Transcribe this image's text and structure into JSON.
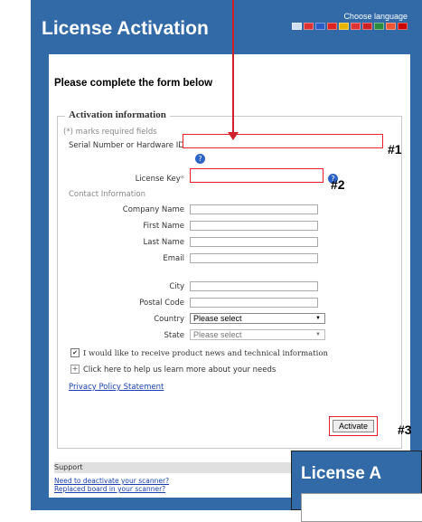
{
  "window": {
    "title": "License Activation",
    "choose_language": "Choose language",
    "flags": [
      "#cfe0f2",
      "#d33",
      "#2a5cc6",
      "#d22",
      "#e8b400",
      "#d33",
      "#c22",
      "#2c8a3c",
      "#e53",
      "#c00"
    ]
  },
  "form": {
    "heading": "Please complete the form below",
    "legend": "Activation information",
    "required_note": "(*) marks required fields",
    "serial_label": "Serial Number or Hardware ID",
    "serial_value": "",
    "license_label": "License Key",
    "license_star": "*",
    "license_value": "",
    "contact_info": "Contact Information",
    "company_label": "Company Name",
    "first_name_label": "First Name",
    "last_name_label": "Last Name",
    "email_label": "Email",
    "city_label": "City",
    "postal_label": "Postal Code",
    "country_label": "Country",
    "country_value": "Please select",
    "state_label": "State",
    "state_value": "Please select",
    "newsletter_text": "I would like to receive product news and technical information",
    "newsletter_checked": true,
    "expand_text": "Click here to help us learn more about your needs",
    "privacy_link": "Privacy Policy Statement",
    "activate_label": "Activate"
  },
  "support": {
    "title": "Support",
    "link_deactivate": "Need to deactivate your scanner?",
    "link_replaced": "Replaced board in your scanner?"
  },
  "annotations": {
    "one": "#1",
    "two": "#2",
    "three": "#3",
    "highlight_color": "#e8202a"
  },
  "overlay": {
    "title": "License A"
  }
}
